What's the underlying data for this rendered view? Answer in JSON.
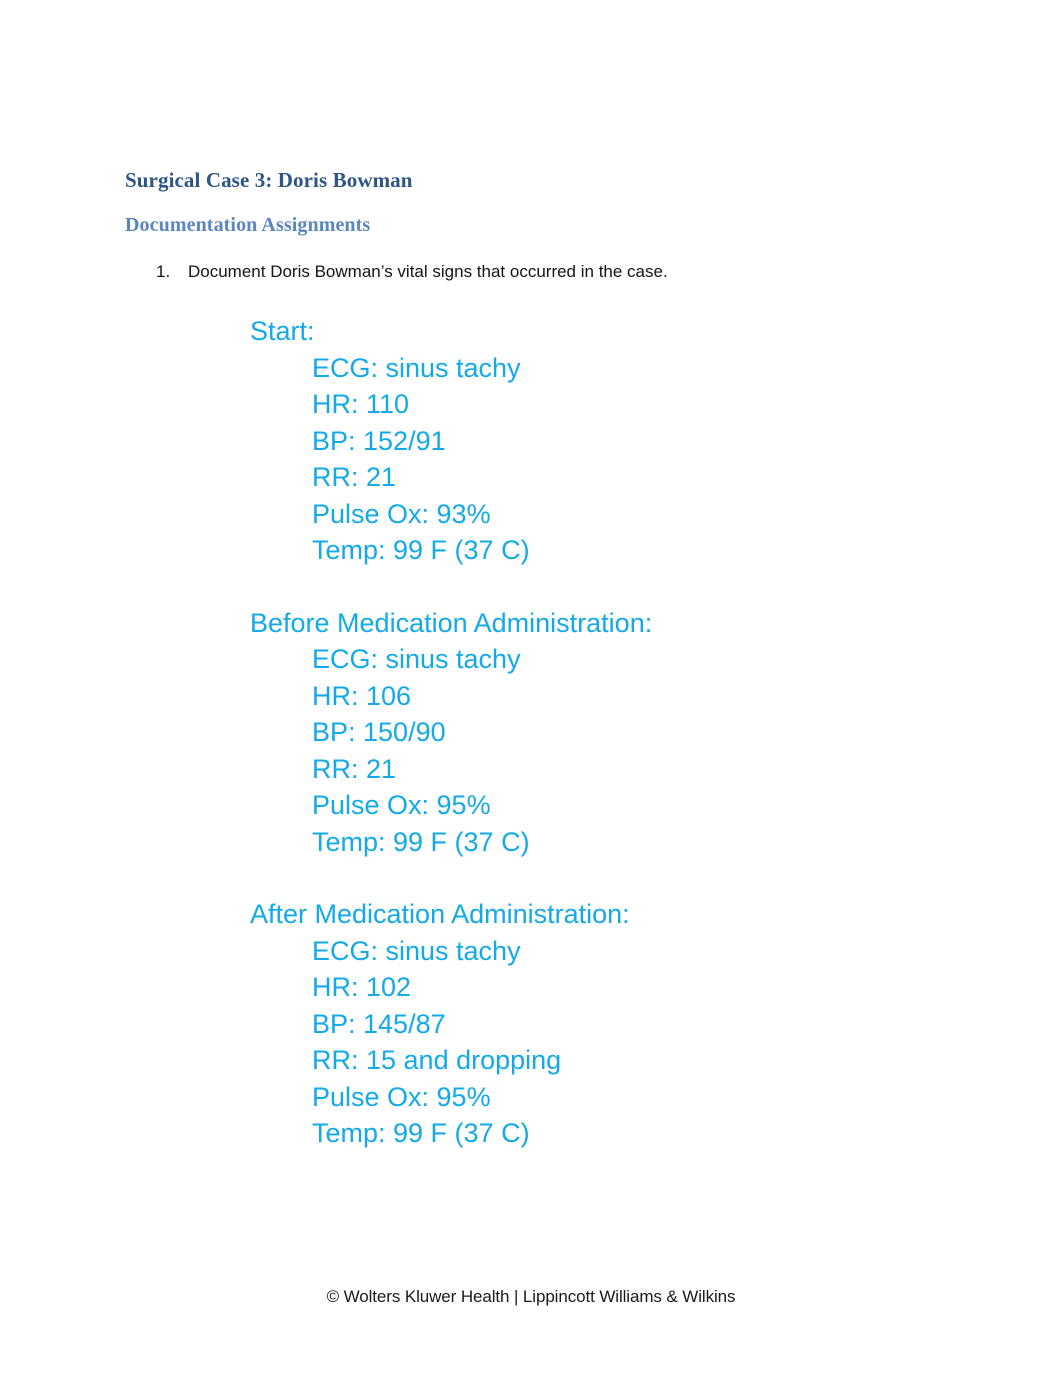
{
  "document": {
    "title": "Surgical Case 3: Doris Bowman",
    "subtitle": "Documentation Assignments",
    "footer": "© Wolters Kluwer Health | Lippincott Williams & Wilkins"
  },
  "colors": {
    "title": "#2E5586",
    "subtitle": "#5B86BE",
    "vitals": "#14A9E8",
    "body_text": "#141414",
    "page_background": "#FFFFFF"
  },
  "tasks": [
    {
      "number": "1.",
      "text": "Document Doris Bowman’s vital signs that occurred in the case."
    }
  ],
  "vital_sign_blocks": [
    {
      "heading": "Start:",
      "lines": [
        "ECG: sinus tachy",
        "HR: 110",
        "BP: 152/91",
        "RR: 21",
        "Pulse Ox: 93%",
        "Temp: 99 F (37 C)"
      ],
      "readings": {
        "ecg": "sinus tachy",
        "hr": 110,
        "bp_systolic": 152,
        "bp_diastolic": 91,
        "rr": 21,
        "pulse_ox_percent": 93,
        "temp_f": 99,
        "temp_c": 37
      }
    },
    {
      "heading": "Before Medication Administration:",
      "lines": [
        "ECG: sinus tachy",
        "HR: 106",
        "BP: 150/90",
        "RR: 21",
        "Pulse Ox: 95%",
        "Temp: 99 F (37 C)"
      ],
      "readings": {
        "ecg": "sinus tachy",
        "hr": 106,
        "bp_systolic": 150,
        "bp_diastolic": 90,
        "rr": 21,
        "pulse_ox_percent": 95,
        "temp_f": 99,
        "temp_c": 37
      }
    },
    {
      "heading": "After Medication Administration:",
      "lines": [
        "ECG: sinus tachy",
        "HR: 102",
        "BP: 145/87",
        "RR: 15 and dropping",
        "Pulse Ox: 95%",
        "Temp: 99 F (37 C)"
      ],
      "readings": {
        "ecg": "sinus tachy",
        "hr": 102,
        "bp_systolic": 145,
        "bp_diastolic": 87,
        "rr": 15,
        "rr_note": "and dropping",
        "pulse_ox_percent": 95,
        "temp_f": 99,
        "temp_c": 37
      }
    }
  ]
}
